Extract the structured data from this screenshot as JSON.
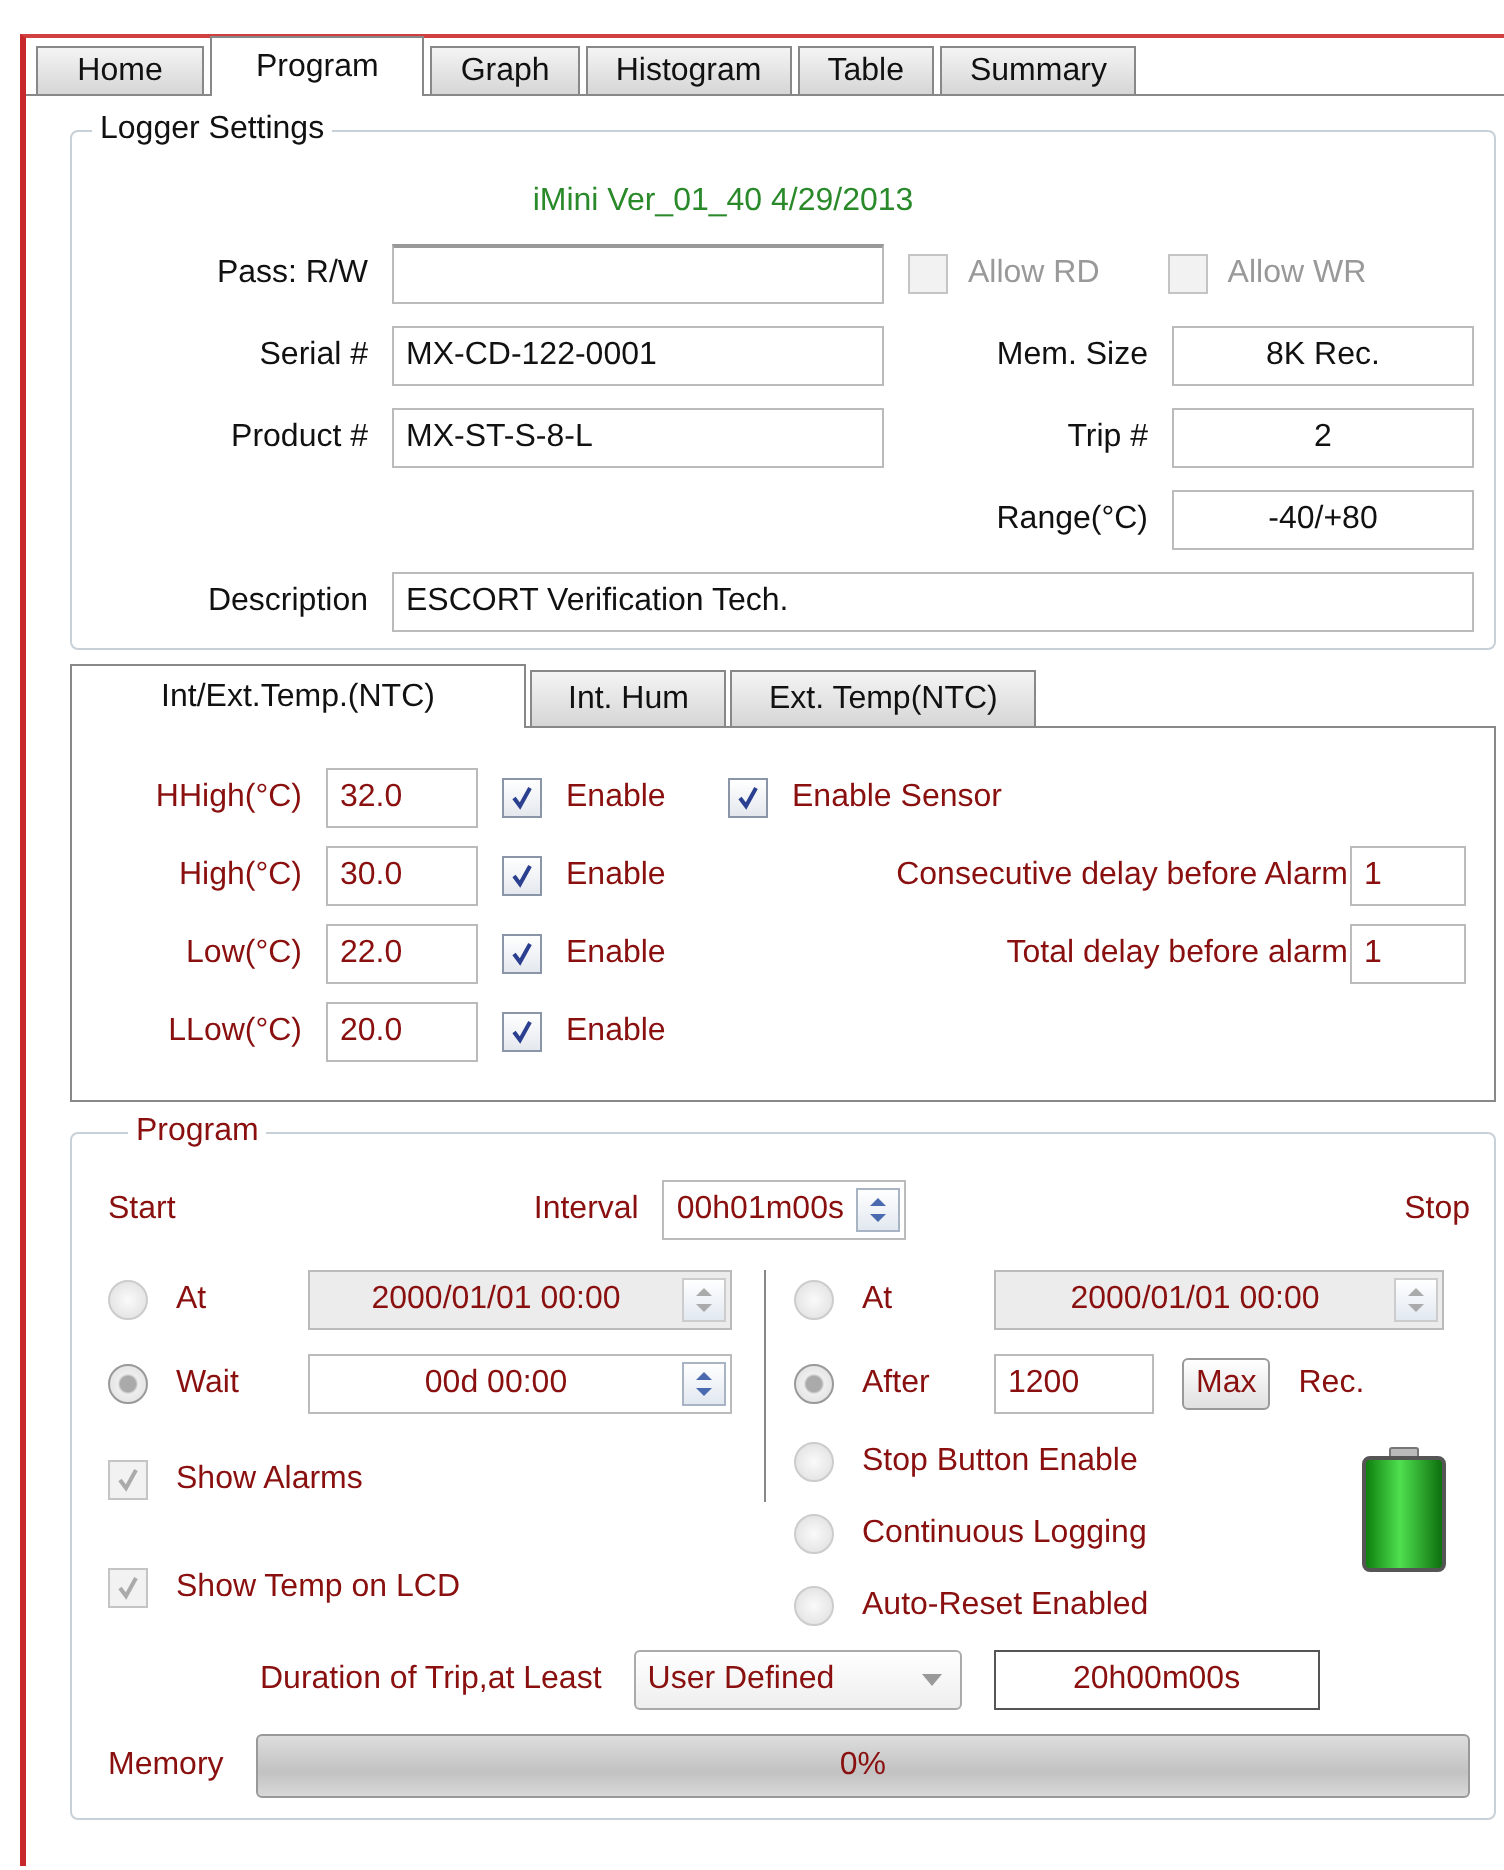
{
  "tabs": [
    {
      "label": "Home",
      "selected": false
    },
    {
      "label": "Program",
      "selected": true
    },
    {
      "label": "Graph",
      "selected": false
    },
    {
      "label": "Histogram",
      "selected": false
    },
    {
      "label": "Table",
      "selected": false
    },
    {
      "label": "Summary",
      "selected": false
    }
  ],
  "logger_settings": {
    "title": "Logger Settings",
    "version": "iMini Ver_01_40 4/29/2013",
    "pass": {
      "label": "Pass: R/W"
    },
    "permissions": [
      {
        "label": "Allow RD",
        "checked": false,
        "disabled": true
      },
      {
        "label": "Allow WR",
        "checked": false,
        "disabled": true
      }
    ],
    "fields": [
      {
        "label": "Serial #",
        "value": "MX-CD-122-0001"
      },
      {
        "label": "Product #",
        "value": "MX-ST-S-8-L"
      }
    ],
    "info": [
      {
        "label": "Mem. Size",
        "value": "8K Rec."
      },
      {
        "label": "Trip #",
        "value": "2"
      },
      {
        "label": "Range(°C)",
        "value": "-40/+80"
      }
    ],
    "description": {
      "label": "Description",
      "value": "ESCORT Verification Tech."
    }
  },
  "sensor_tabs": [
    {
      "label": "Int/Ext.Temp.(NTC)",
      "selected": true
    },
    {
      "label": "Int. Hum",
      "selected": false
    },
    {
      "label": "Ext. Temp(NTC)",
      "selected": false
    }
  ],
  "alarms": [
    {
      "label": "HHigh(°C)",
      "value": "32.0",
      "enable_label": "Enable",
      "checked": true
    },
    {
      "label": "High(°C)",
      "value": "30.0",
      "enable_label": "Enable",
      "checked": true
    },
    {
      "label": "Low(°C)",
      "value": "22.0",
      "enable_label": "Enable",
      "checked": true
    },
    {
      "label": "LLow(°C)",
      "value": "20.0",
      "enable_label": "Enable",
      "checked": true
    }
  ],
  "enable_sensor": {
    "label": "Enable Sensor",
    "checked": true
  },
  "delays": [
    {
      "label": "Consecutive delay before Alarm",
      "value": "1"
    },
    {
      "label": "Total delay before alarm",
      "value": "1"
    }
  ],
  "program": {
    "title": "Program",
    "start_label": "Start",
    "interval": {
      "label": "Interval",
      "value": "00h01m00s"
    },
    "stop_label": "Stop",
    "start_options": [
      {
        "label": "At",
        "value": "2000/01/01 00:00",
        "selected": false,
        "disabled": true
      },
      {
        "label": "Wait",
        "value": "00d 00:00",
        "selected": true,
        "disabled": false
      }
    ],
    "display_options": [
      {
        "label": "Show Alarms",
        "checked": true,
        "disabled": true
      },
      {
        "label": "Show Temp on LCD",
        "checked": true,
        "disabled": true
      }
    ],
    "stop_options": [
      {
        "kind": "datetime",
        "label": "At",
        "value": "2000/01/01 00:00",
        "selected": false
      },
      {
        "kind": "records",
        "label": "After",
        "value": "1200",
        "button": "Max",
        "unit": "Rec.",
        "selected": true
      },
      {
        "kind": "plain",
        "label": "Stop Button Enable",
        "selected": false
      },
      {
        "kind": "plain",
        "label": "Continuous Logging",
        "selected": false
      },
      {
        "kind": "plain",
        "label": "Auto-Reset Enabled",
        "selected": false
      }
    ],
    "duration": {
      "label": "Duration of Trip,at Least",
      "choice": "User Defined",
      "value": "20h00m00s"
    },
    "memory": {
      "label": "Memory",
      "level": 0,
      "reading": "0%"
    }
  }
}
